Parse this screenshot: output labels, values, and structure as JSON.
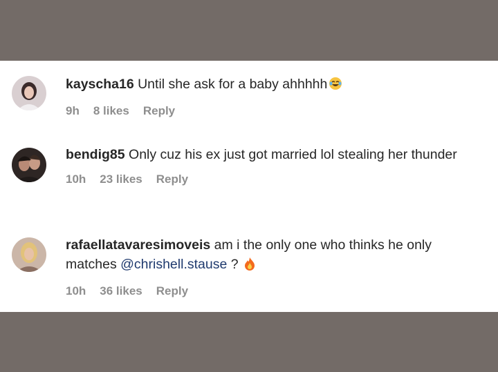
{
  "comments": [
    {
      "username": "kayscha16",
      "text": "Until she ask for a baby ahhhhh",
      "emoji": "laughing-tears-emoji",
      "time": "9h",
      "likes": "8 likes",
      "reply": "Reply"
    },
    {
      "username": "bendig85",
      "text": "Only cuz his ex just got married lol stealing her thunder",
      "time": "10h",
      "likes": "23 likes",
      "reply": "Reply"
    },
    {
      "username": "rafaellatavaresimoveis",
      "text": "am i the only one who thinks he only matches",
      "mention": "@chrishell.stause",
      "text_after": " ? ",
      "emoji": "fire-emoji",
      "time": "10h",
      "likes": "36 likes",
      "reply": "Reply"
    }
  ],
  "colors": {
    "background_band": "#736b67",
    "panel": "#ffffff",
    "text": "#262626",
    "meta": "#8e8e8e",
    "mention": "#1f3a6e"
  }
}
